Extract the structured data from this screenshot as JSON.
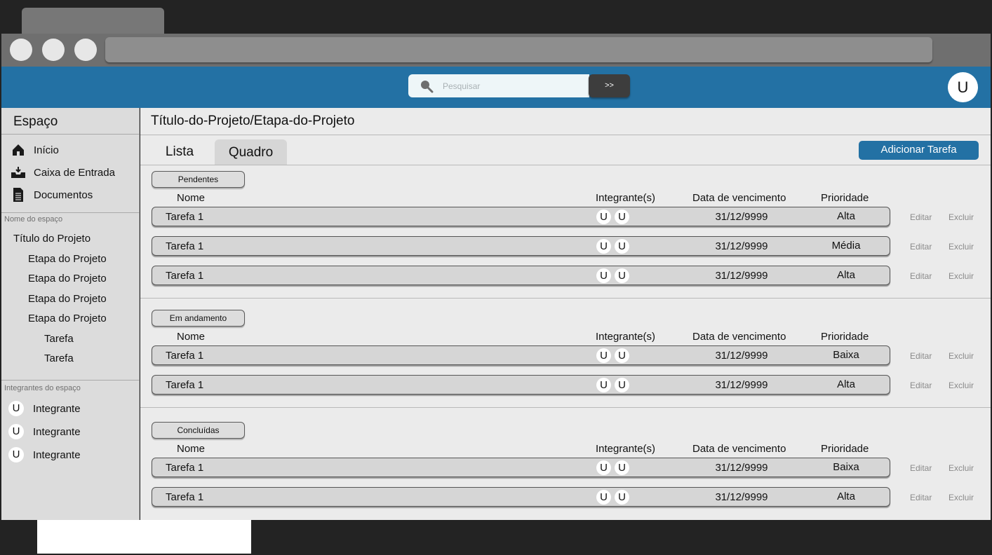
{
  "header": {
    "search_placeholder": "Pesquisar",
    "search_button_label": ">>",
    "user_avatar": "U",
    "accent_color": "#2371a4"
  },
  "sidebar": {
    "title": "Espaço",
    "nav": [
      {
        "label": "Início",
        "icon": "home-icon"
      },
      {
        "label": "Caixa de Entrada",
        "icon": "inbox-icon"
      },
      {
        "label": "Documentos",
        "icon": "document-icon"
      }
    ],
    "space_section_label": "Nome do espaço",
    "project_title": "Título do Projeto",
    "stages": [
      "Etapa do Projeto",
      "Etapa do Projeto",
      "Etapa do Projeto",
      "Etapa do Projeto"
    ],
    "tasks": [
      "Tarefa",
      "Tarefa"
    ],
    "members_section_label": "Integrantes do espaço",
    "members": [
      {
        "avatar": "U",
        "name": "Integrante"
      },
      {
        "avatar": "U",
        "name": "Integrante"
      },
      {
        "avatar": "U",
        "name": "Integrante"
      }
    ]
  },
  "main": {
    "breadcrumb": "Título-do-Projeto/Etapa-do-Projeto",
    "tabs": [
      {
        "label": "Lista",
        "active": false
      },
      {
        "label": "Quadro",
        "active": true
      }
    ],
    "add_task_label": "Adicionar Tarefa",
    "columns": {
      "name": "Nome",
      "members": "Integrante(s)",
      "due_date": "Data de vencimento",
      "priority": "Prioridade"
    },
    "actions": {
      "edit": "Editar",
      "delete": "Excluir"
    },
    "groups": [
      {
        "label": "Pendentes",
        "tasks": [
          {
            "name": "Tarefa 1",
            "avatars": [
              "U",
              "U"
            ],
            "due": "31/12/9999",
            "priority": "Alta"
          },
          {
            "name": "Tarefa 1",
            "avatars": [
              "U",
              "U"
            ],
            "due": "31/12/9999",
            "priority": "Média"
          },
          {
            "name": "Tarefa 1",
            "avatars": [
              "U",
              "U"
            ],
            "due": "31/12/9999",
            "priority": "Alta"
          }
        ]
      },
      {
        "label": "Em andamento",
        "tasks": [
          {
            "name": "Tarefa 1",
            "avatars": [
              "U",
              "U"
            ],
            "due": "31/12/9999",
            "priority": "Baixa"
          },
          {
            "name": "Tarefa 1",
            "avatars": [
              "U",
              "U"
            ],
            "due": "31/12/9999",
            "priority": "Alta"
          }
        ]
      },
      {
        "label": "Concluídas",
        "tasks": [
          {
            "name": "Tarefa 1",
            "avatars": [
              "U",
              "U"
            ],
            "due": "31/12/9999",
            "priority": "Baixa"
          },
          {
            "name": "Tarefa 1",
            "avatars": [
              "U",
              "U"
            ],
            "due": "31/12/9999",
            "priority": "Alta"
          }
        ]
      }
    ]
  }
}
